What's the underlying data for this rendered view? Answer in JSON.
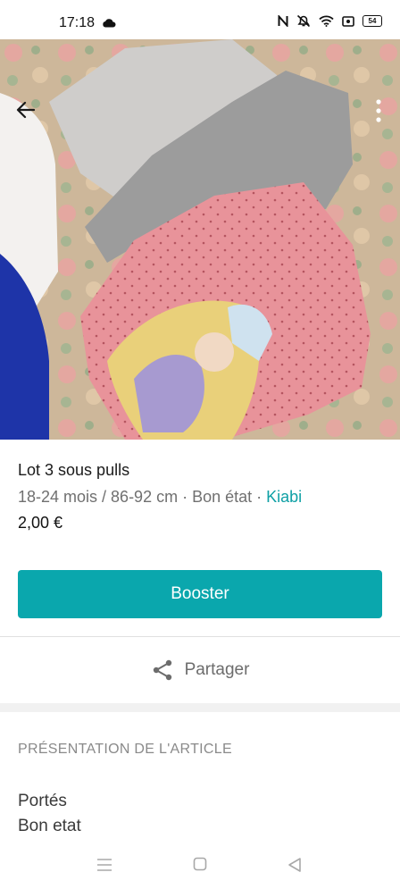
{
  "status_bar": {
    "time": "17:18",
    "battery": "54",
    "icons": [
      "cloud-icon",
      "nfc-icon",
      "mute-icon",
      "wifi-icon",
      "screen-record-icon",
      "battery-icon"
    ]
  },
  "photo": {
    "icons": [
      "back-arrow-icon",
      "more-vertical-icon"
    ]
  },
  "item": {
    "title": "Lot 3 sous pulls",
    "meta_prefix": "18-24 mois / 86-92 cm · Bon état · ",
    "brand": "Kiabi",
    "price": "2,00 €"
  },
  "actions": {
    "booster_label": "Booster",
    "share_label": "Partager",
    "share_icon": "share-icon"
  },
  "presentation": {
    "header": "PRÉSENTATION DE L'ARTICLE",
    "line1": "Portés",
    "line2": "Bon etat"
  },
  "nav_bar": {
    "icons": [
      "menu-icon",
      "home-icon",
      "back-icon"
    ]
  },
  "colors": {
    "accent": "#0aa7ad",
    "brand_link": "#0fa0a5"
  }
}
